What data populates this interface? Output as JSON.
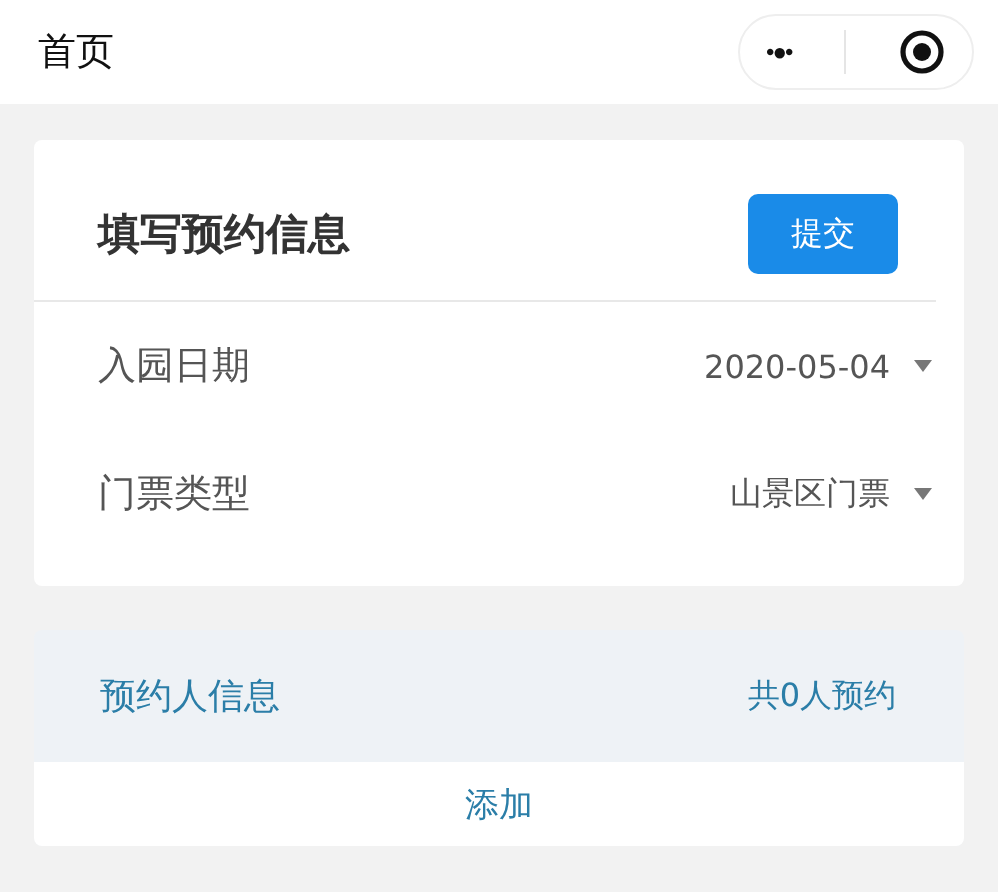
{
  "nav_bar": {
    "title": "首页",
    "menu_icon": "•●•"
  },
  "booking_form": {
    "title": "填写预约信息",
    "submit_button": "提交",
    "fields": [
      {
        "label": "入园日期",
        "value": "2020-05-04"
      },
      {
        "label": "门票类型",
        "value": "山景区门票"
      }
    ]
  },
  "visitors": {
    "title": "预约人信息",
    "count": "共0人预约",
    "add_button": "添加"
  }
}
